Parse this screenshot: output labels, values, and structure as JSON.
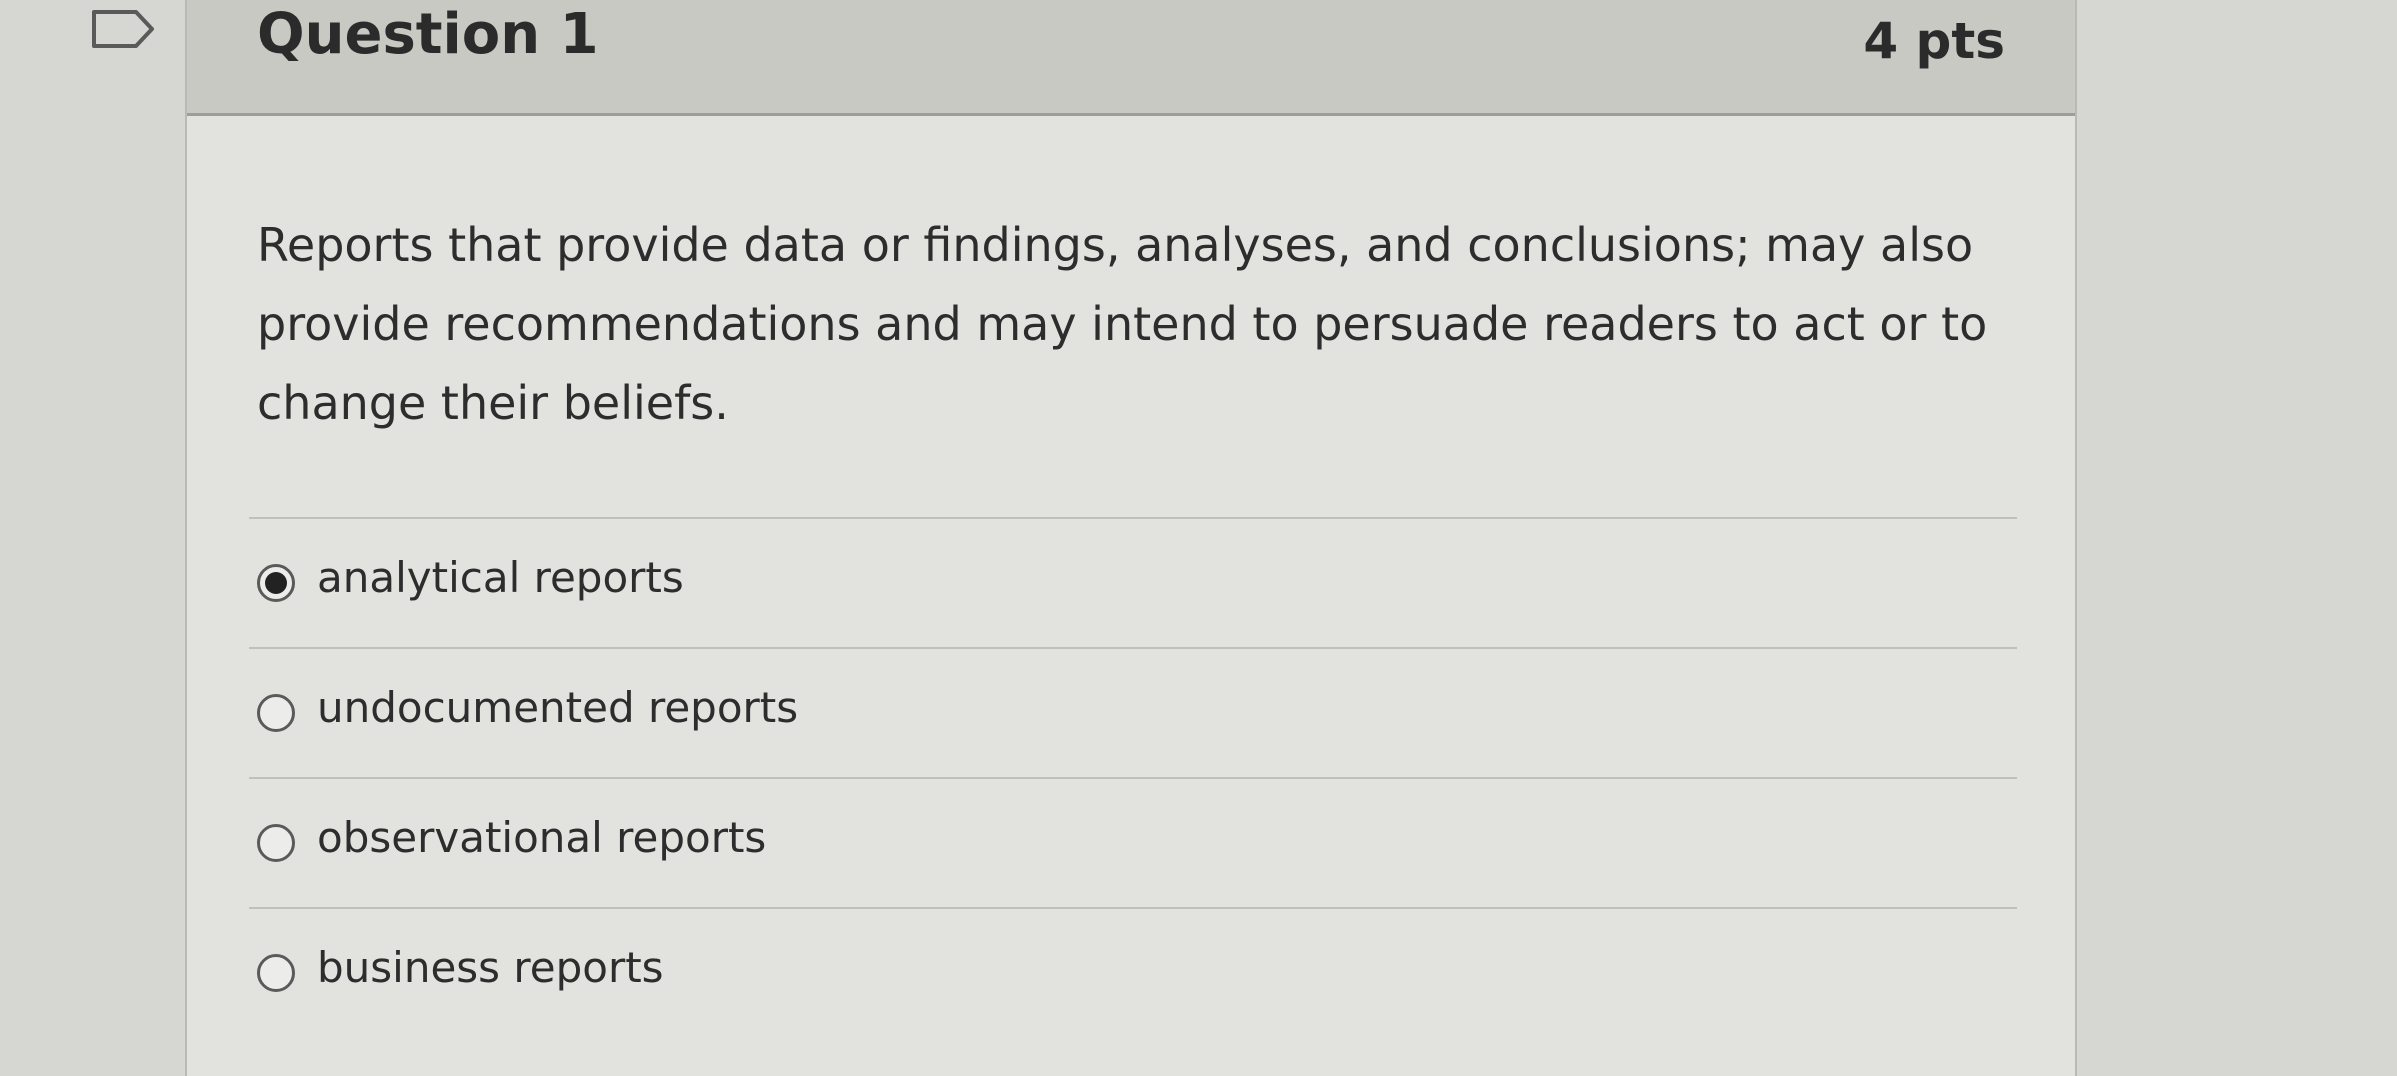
{
  "question": {
    "title": "Question 1",
    "points": "4 pts",
    "text": "Reports that provide data or findings, analyses, and conclusions; may also provide recommendations and may intend to persuade readers to act or to change their beliefs."
  },
  "answers": [
    {
      "label": "analytical reports",
      "selected": true
    },
    {
      "label": "undocumented reports",
      "selected": false
    },
    {
      "label": "observational reports",
      "selected": false
    },
    {
      "label": "business reports",
      "selected": false
    }
  ],
  "colors": {
    "page_background": "#d6d6d3",
    "card_background": "#e2e2df",
    "header_background": "#c9c9c3",
    "text": "#2d2d2d"
  },
  "icons": {
    "flag": "bookmark-flag-icon"
  }
}
